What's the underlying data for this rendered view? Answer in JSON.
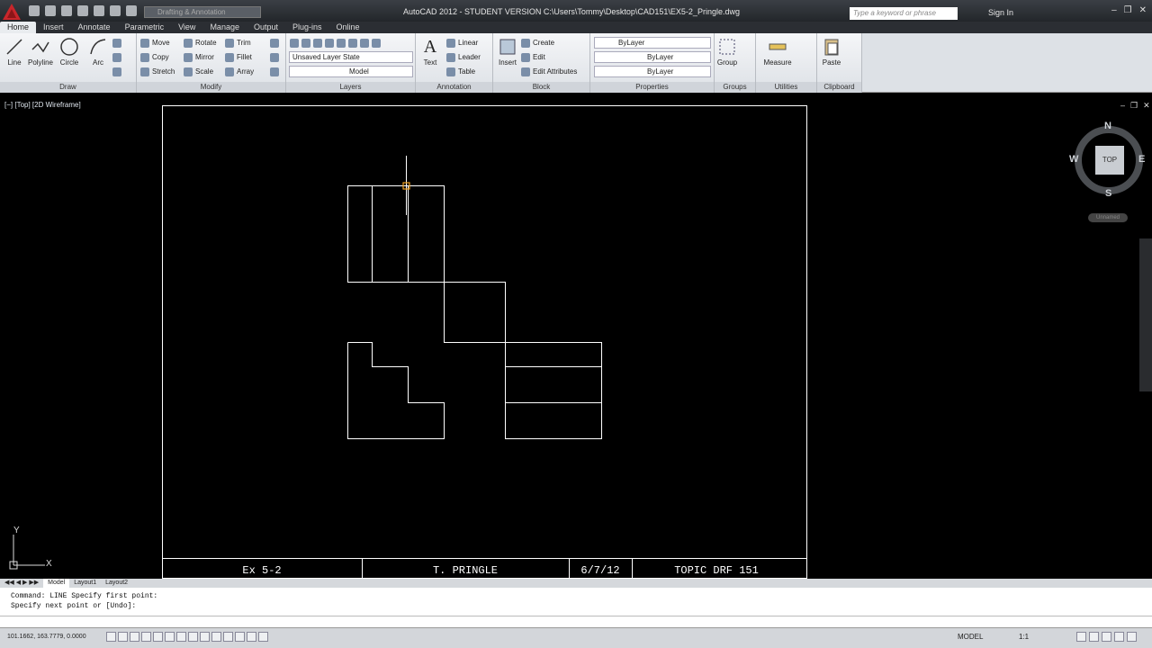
{
  "titlebar": {
    "workspace": "Drafting & Annotation",
    "title": "AutoCAD 2012 - STUDENT VERSION    C:\\Users\\Tommy\\Desktop\\CAD151\\EX5-2_Pringle.dwg",
    "search_placeholder": "Type a keyword or phrase",
    "sign_in": "Sign In"
  },
  "tabs": [
    "Home",
    "Insert",
    "Annotate",
    "Parametric",
    "View",
    "Manage",
    "Output",
    "Plug-ins",
    "Online"
  ],
  "ribbon": {
    "draw": {
      "title": "Draw",
      "line": "Line",
      "polyline": "Polyline",
      "circle": "Circle",
      "arc": "Arc"
    },
    "modify": {
      "title": "Modify",
      "move": "Move",
      "rotate": "Rotate",
      "trim": "Trim",
      "copy": "Copy",
      "mirror": "Mirror",
      "fillet": "Fillet",
      "stretch": "Stretch",
      "scale": "Scale",
      "array": "Array"
    },
    "layers": {
      "title": "Layers",
      "layer_state": "Unsaved Layer State",
      "current_layer": "Model"
    },
    "annotation": {
      "title": "Annotation",
      "text": "Text",
      "linear": "Linear",
      "leader": "Leader",
      "table": "Table"
    },
    "block": {
      "title": "Block",
      "insert": "Insert",
      "create": "Create",
      "edit": "Edit",
      "edit_attributes": "Edit Attributes"
    },
    "properties": {
      "title": "Properties",
      "color": "ByLayer",
      "linetype": "ByLayer",
      "lineweight": "ByLayer"
    },
    "groups": {
      "title": "Groups",
      "group": "Group"
    },
    "utilities": {
      "title": "Utilities",
      "measure": "Measure"
    },
    "clipboard": {
      "title": "Clipboard",
      "paste": "Paste"
    }
  },
  "viewport": {
    "label": "[−] [Top] [2D Wireframe]",
    "title_block": [
      "Ex 5-2",
      "T. PRINGLE",
      "6/7/12",
      "TOPIC DRF 151"
    ],
    "viewcube": {
      "top": "TOP",
      "n": "N",
      "s": "S",
      "e": "E",
      "w": "W",
      "wcs": "Unnamed"
    },
    "ucs": {
      "x": "X",
      "y": "Y"
    }
  },
  "layout_tabs": [
    "Model",
    "Layout1",
    "Layout2"
  ],
  "command": {
    "line1": "Command:  LINE Specify first point:",
    "line2": "Specify next point or [Undo]:"
  },
  "status": {
    "coords": "101.1662, 163.7779, 0.0000",
    "model": "MODEL",
    "scale": "1:1"
  },
  "colors": {
    "drawing_lines": "#ffffff",
    "cursor": "#ffffff",
    "cursor_box": "#f0a020"
  }
}
